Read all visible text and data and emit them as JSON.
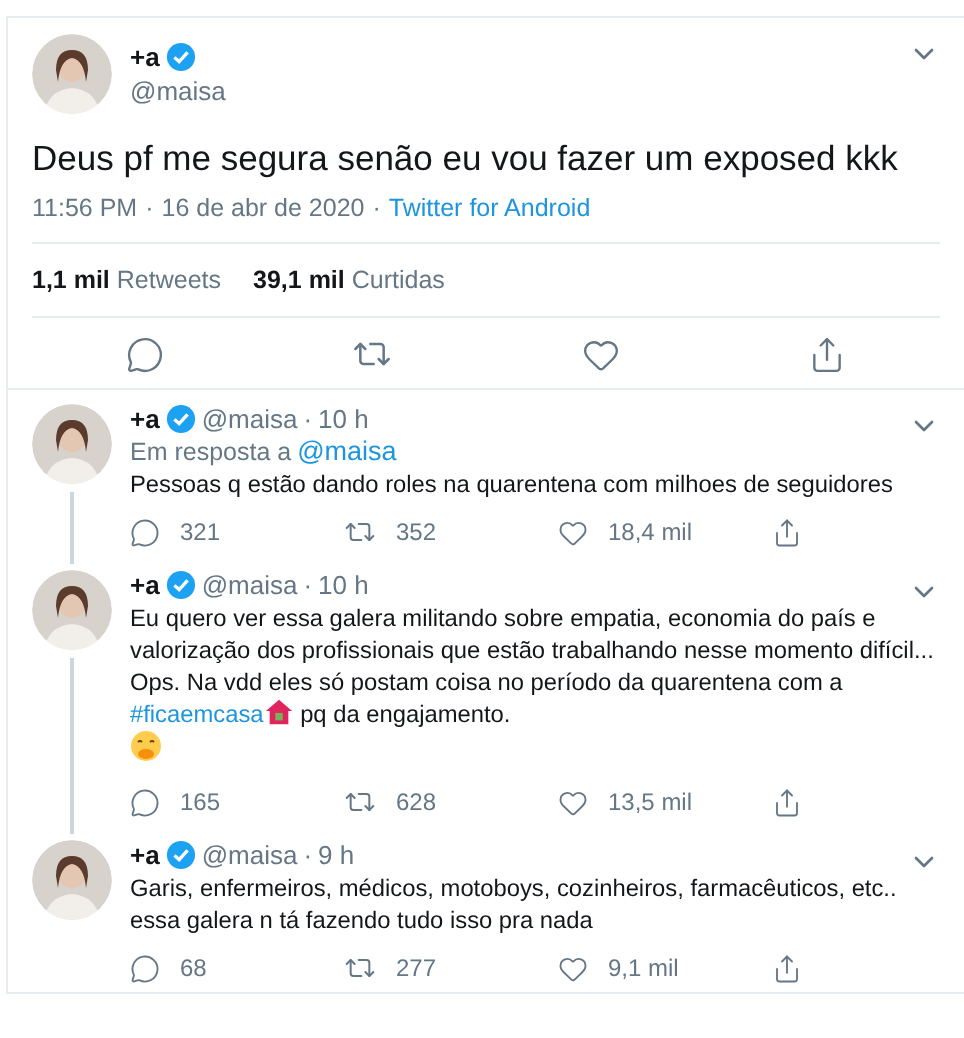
{
  "main_tweet": {
    "name": "+a",
    "verified": true,
    "handle": "@maisa",
    "text": "Deus pf me segura senão eu vou fazer um exposed kkk",
    "time": "11:56 PM",
    "separator": "·",
    "date": "16 de abr de 2020",
    "source_separator": "·",
    "source": "Twitter for Android",
    "stats": [
      {
        "count": "1,1 mil",
        "label": "Retweets"
      },
      {
        "count": "39,1 mil",
        "label": "Curtidas"
      }
    ]
  },
  "replies": [
    {
      "name": "+a",
      "verified": true,
      "handle": "@maisa",
      "separator": "·",
      "time": "10 h",
      "in_reply_to": {
        "prefix": "Em resposta a",
        "handle": "@maisa"
      },
      "parts": [
        {
          "kind": "text",
          "text": "Pessoas q estão dando roles na quarentena com milhoes de seguidores"
        }
      ],
      "replies": "321",
      "retweets": "352",
      "likes": "18,4 mil"
    },
    {
      "name": "+a",
      "verified": true,
      "handle": "@maisa",
      "separator": "·",
      "time": "10 h",
      "parts": [
        {
          "kind": "text",
          "text": "Eu quero ver essa galera militando sobre empatia, economia do país e valorização dos profissionais que estão trabalhando nesse momento difícil... Ops. Na vdd eles só postam coisa no período da quarentena com a "
        },
        {
          "kind": "break"
        },
        {
          "kind": "link",
          "text": "#ficaemcasa"
        },
        {
          "kind": "house"
        },
        {
          "kind": "text",
          "text": " pq da engajamento."
        },
        {
          "kind": "break"
        },
        {
          "kind": "giggle"
        }
      ],
      "replies": "165",
      "retweets": "628",
      "likes": "13,5 mil"
    },
    {
      "name": "+a",
      "verified": true,
      "handle": "@maisa",
      "separator": "·",
      "time": "9 h",
      "parts": [
        {
          "kind": "text",
          "text": "Garis, enfermeiros, médicos, motoboys, cozinheiros, farmacêuticos, etc.. essa galera n tá fazendo tudo isso pra nada"
        }
      ],
      "replies": "68",
      "retweets": "277",
      "likes": "9,1 mil"
    }
  ]
}
